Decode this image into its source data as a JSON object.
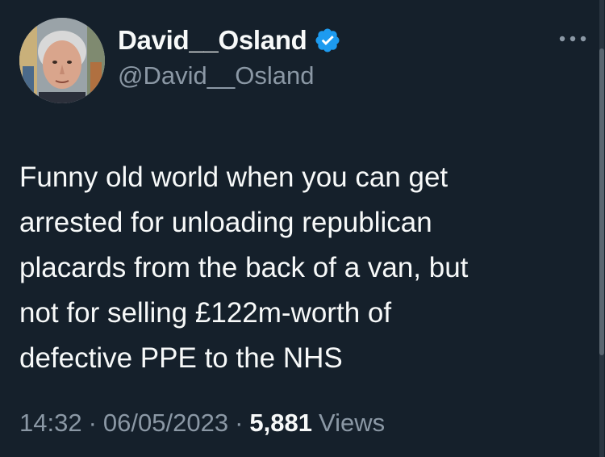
{
  "author": {
    "display_name": "David__Osland",
    "handle": "@David__Osland",
    "verified": true,
    "verified_color": "#1d9bf0"
  },
  "tweet": {
    "text_lines": [
      "Funny old world when you can get",
      "arrested for unloading republican",
      "placards from the back of a van, but",
      "not for selling £122m-worth of",
      "defective PPE to the NHS"
    ]
  },
  "meta": {
    "time": "14:32",
    "separator": "·",
    "date": "06/05/2023",
    "views_count": "5,881",
    "views_label": "Views"
  },
  "icons": {
    "more": "more-horizontal-icon",
    "verified": "verified-badge-icon"
  },
  "colors": {
    "background": "#15202b",
    "primary_text": "#f7f9f9",
    "secondary_text": "#8b98a5"
  }
}
